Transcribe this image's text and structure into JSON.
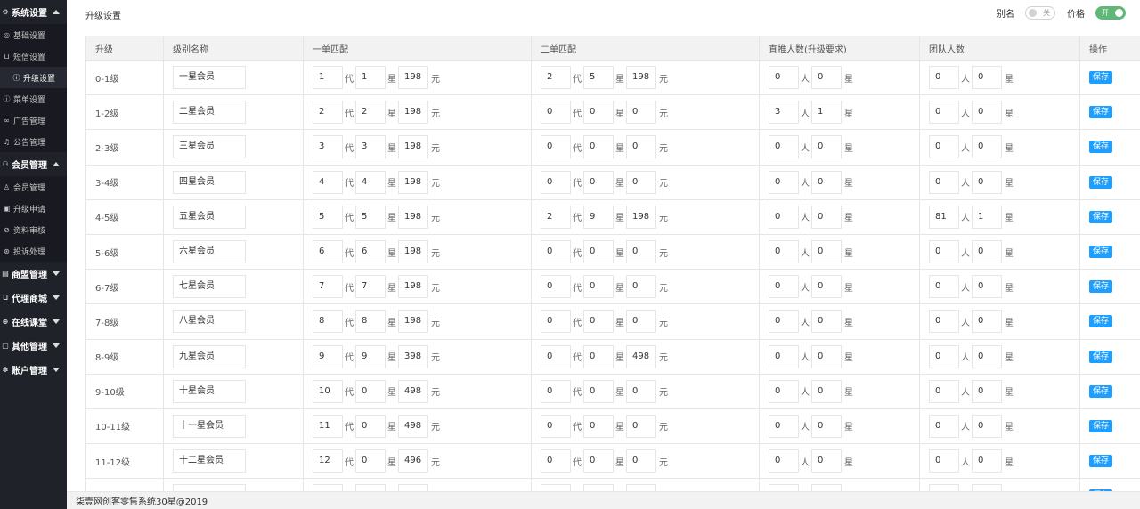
{
  "sidebar": {
    "groups": [
      {
        "label": "系统设置",
        "icon": "gear-icon",
        "glyph": "⚙",
        "open": true,
        "items": [
          {
            "label": "基础设置",
            "icon": "globe-icon",
            "glyph": "◎"
          },
          {
            "label": "短信设置",
            "icon": "message-icon",
            "glyph": "⊔"
          },
          {
            "label": "升级设置",
            "icon": "upgrade-icon",
            "glyph": "ⓘ",
            "active": true
          },
          {
            "label": "菜单设置",
            "icon": "menu-icon",
            "glyph": "ⓘ"
          },
          {
            "label": "广告管理",
            "icon": "ad-icon",
            "glyph": "∞"
          },
          {
            "label": "公告管理",
            "icon": "bell-icon",
            "glyph": "♫"
          }
        ]
      },
      {
        "label": "会员管理",
        "icon": "users-icon",
        "glyph": "⚇",
        "open": true,
        "items": [
          {
            "label": "会员管理",
            "icon": "user-icon",
            "glyph": "♙"
          },
          {
            "label": "升级申请",
            "icon": "apply-icon",
            "glyph": "▣"
          },
          {
            "label": "资料审核",
            "icon": "check-icon",
            "glyph": "⊘"
          },
          {
            "label": "投诉处理",
            "icon": "complaint-icon",
            "glyph": "⊛"
          }
        ]
      },
      {
        "label": "商盟管理",
        "icon": "shop-icon",
        "glyph": "▤",
        "open": false,
        "items": []
      },
      {
        "label": "代理商城",
        "icon": "cart-icon",
        "glyph": "⊔",
        "open": false,
        "items": []
      },
      {
        "label": "在线课堂",
        "icon": "class-icon",
        "glyph": "⊕",
        "open": false,
        "items": []
      },
      {
        "label": "其他管理",
        "icon": "other-icon",
        "glyph": "▢",
        "open": false,
        "items": []
      },
      {
        "label": "账户管理",
        "icon": "account-icon",
        "glyph": "✽",
        "open": false,
        "items": []
      }
    ]
  },
  "header": {
    "title": "升级设置",
    "alias_label": "别名",
    "alias_state": "关",
    "price_label": "价格",
    "price_state": "开"
  },
  "table": {
    "columns": [
      "升级",
      "级别名称",
      "一单匹配",
      "二单匹配",
      "直推人数(升级要求)",
      "团队人数",
      "操作"
    ],
    "units": {
      "generation": "代",
      "star": "星",
      "yuan": "元",
      "person": "人"
    },
    "save_label": "保存",
    "rows": [
      {
        "level": "0-1级",
        "name": "一星会员",
        "m1": [
          "1",
          "1",
          "198"
        ],
        "m2": [
          "2",
          "5",
          "198"
        ],
        "direct": [
          "0",
          "0"
        ],
        "team": [
          "0",
          "0"
        ]
      },
      {
        "level": "1-2级",
        "name": "二星会员",
        "m1": [
          "2",
          "2",
          "198"
        ],
        "m2": [
          "0",
          "0",
          "0"
        ],
        "direct": [
          "3",
          "1"
        ],
        "team": [
          "0",
          "0"
        ]
      },
      {
        "level": "2-3级",
        "name": "三星会员",
        "m1": [
          "3",
          "3",
          "198"
        ],
        "m2": [
          "0",
          "0",
          "0"
        ],
        "direct": [
          "0",
          "0"
        ],
        "team": [
          "0",
          "0"
        ]
      },
      {
        "level": "3-4级",
        "name": "四星会员",
        "m1": [
          "4",
          "4",
          "198"
        ],
        "m2": [
          "0",
          "0",
          "0"
        ],
        "direct": [
          "0",
          "0"
        ],
        "team": [
          "0",
          "0"
        ]
      },
      {
        "level": "4-5级",
        "name": "五星会员",
        "m1": [
          "5",
          "5",
          "198"
        ],
        "m2": [
          "2",
          "9",
          "198"
        ],
        "direct": [
          "0",
          "0"
        ],
        "team": [
          "81",
          "1"
        ]
      },
      {
        "level": "5-6级",
        "name": "六星会员",
        "m1": [
          "6",
          "6",
          "198"
        ],
        "m2": [
          "0",
          "0",
          "0"
        ],
        "direct": [
          "0",
          "0"
        ],
        "team": [
          "0",
          "0"
        ]
      },
      {
        "level": "6-7级",
        "name": "七星会员",
        "m1": [
          "7",
          "7",
          "198"
        ],
        "m2": [
          "0",
          "0",
          "0"
        ],
        "direct": [
          "0",
          "0"
        ],
        "team": [
          "0",
          "0"
        ]
      },
      {
        "level": "7-8级",
        "name": "八星会员",
        "m1": [
          "8",
          "8",
          "198"
        ],
        "m2": [
          "0",
          "0",
          "0"
        ],
        "direct": [
          "0",
          "0"
        ],
        "team": [
          "0",
          "0"
        ]
      },
      {
        "level": "8-9级",
        "name": "九星会员",
        "m1": [
          "9",
          "9",
          "398"
        ],
        "m2": [
          "0",
          "0",
          "498"
        ],
        "direct": [
          "0",
          "0"
        ],
        "team": [
          "0",
          "0"
        ]
      },
      {
        "level": "9-10级",
        "name": "十星会员",
        "m1": [
          "10",
          "0",
          "498"
        ],
        "m2": [
          "0",
          "0",
          "0"
        ],
        "direct": [
          "0",
          "0"
        ],
        "team": [
          "0",
          "0"
        ]
      },
      {
        "level": "10-11级",
        "name": "十一星会员",
        "m1": [
          "11",
          "0",
          "498"
        ],
        "m2": [
          "0",
          "0",
          "0"
        ],
        "direct": [
          "0",
          "0"
        ],
        "team": [
          "0",
          "0"
        ]
      },
      {
        "level": "11-12级",
        "name": "十二星会员",
        "m1": [
          "12",
          "0",
          "496"
        ],
        "m2": [
          "0",
          "0",
          "0"
        ],
        "direct": [
          "0",
          "0"
        ],
        "team": [
          "0",
          "0"
        ]
      },
      {
        "level": "",
        "name": "",
        "m1": [
          "",
          "",
          ""
        ],
        "m2": [
          "",
          "",
          ""
        ],
        "direct": [
          "",
          ""
        ],
        "team": [
          "",
          ""
        ]
      }
    ]
  },
  "footer": {
    "text": "柒壹网创客零售系统30星@2019"
  }
}
